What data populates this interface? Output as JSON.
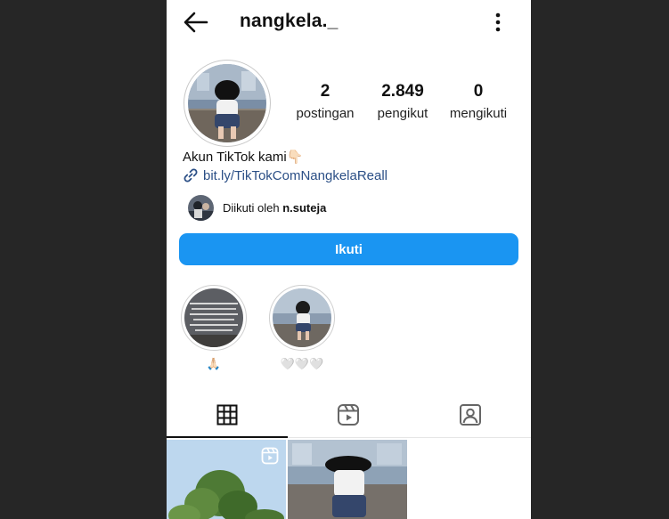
{
  "header": {
    "username": "nangkela._",
    "back_icon": "arrow-left-icon",
    "more_icon": "more-vertical-icon"
  },
  "profile": {
    "stats": [
      {
        "value": "2",
        "label": "postingan"
      },
      {
        "value": "2.849",
        "label": "pengikut"
      },
      {
        "value": "0",
        "label": "mengikuti"
      }
    ],
    "bio_text": "Akun TikTok kami",
    "bio_emoji": "👇🏻",
    "link_icon": "link-icon",
    "link_text": "bit.ly/TikTokComNangkelaReall",
    "followed_prefix": "Diikuti oleh ",
    "followed_by": "n.suteja"
  },
  "actions": {
    "follow_label": "Ikuti"
  },
  "highlights": [
    {
      "label": "🙏🏻"
    },
    {
      "label": "🤍🤍🤍"
    }
  ],
  "tabs": [
    {
      "name": "grid",
      "icon": "grid-icon",
      "active": true
    },
    {
      "name": "reels",
      "icon": "reels-icon",
      "active": false
    },
    {
      "name": "tagged",
      "icon": "tagged-user-icon",
      "active": false
    }
  ],
  "colors": {
    "accent": "#1a95f2",
    "link": "#2b4f86",
    "background_outer": "#262626"
  }
}
